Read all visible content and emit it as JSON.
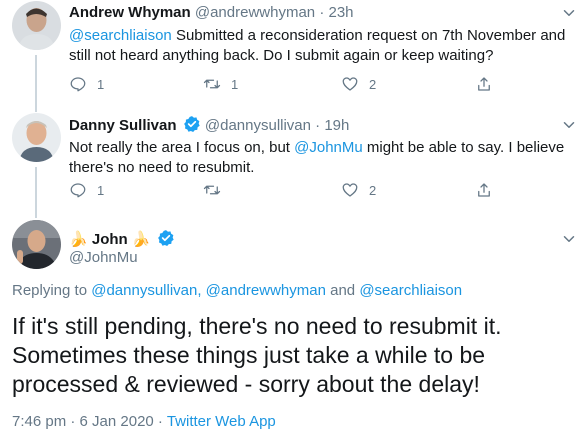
{
  "tweets": [
    {
      "name": "Andrew Whyman",
      "handle": "@andrewwhyman",
      "separator": "·",
      "time": "23h",
      "mention": "@searchliaison",
      "text": " Submitted a reconsideration request on 7th November and still not heard anything back. Do I submit again or keep waiting?",
      "reply_count": "1",
      "retweet_count": "1",
      "like_count": "2"
    },
    {
      "name": "Danny Sullivan",
      "handle": "@dannysullivan",
      "separator": "·",
      "time": "19h",
      "text_before": "Not really the area I focus on, but ",
      "mention": "@JohnMu",
      "text_after": " might be able to say. I believe there's no need to resubmit.",
      "reply_count": "1",
      "retweet_count": "",
      "like_count": "2"
    }
  ],
  "main_tweet": {
    "name": "John",
    "banana": "🍌",
    "handle": "@JohnMu",
    "replying_prefix": "Replying to ",
    "replying_mentions_1": "@dannysullivan, @andrewwhyman",
    "replying_and": " and ",
    "replying_mentions_2": "@searchliaison",
    "text": "If it's still pending, there's no need to resubmit it. Sometimes these things just take a while to be processed & reviewed - sorry about the delay!",
    "timestamp": "7:46 pm · 6 Jan 2020 · ",
    "app": "Twitter Web App"
  },
  "colors": {
    "link": "#1b95e0",
    "secondary": "#657786",
    "verified": "#1da1f2"
  },
  "icons": [
    "reply-icon",
    "retweet-icon",
    "like-icon",
    "share-icon",
    "verified-icon",
    "chevron-down-icon"
  ]
}
